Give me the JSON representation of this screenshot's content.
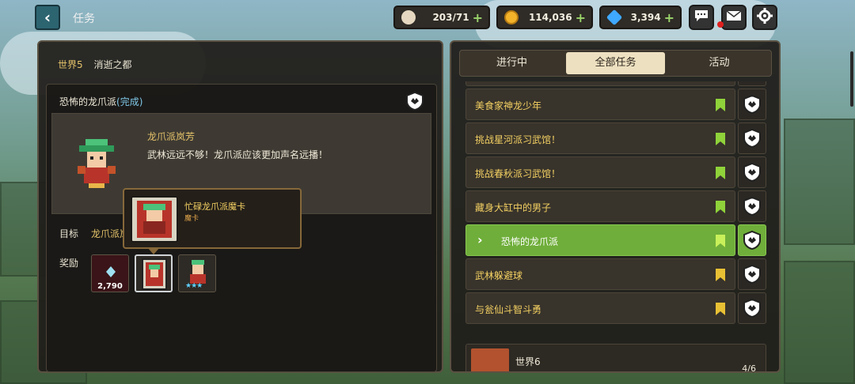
{
  "header": {
    "back_icon": "chevron-left-icon",
    "title": "任务",
    "resources": [
      {
        "name": "stamina",
        "icon": "coffee-cup-icon",
        "value": "203/71"
      },
      {
        "name": "gold",
        "icon": "gold-coin-icon",
        "value": "114,036"
      },
      {
        "name": "gems",
        "icon": "diamond-icon",
        "value": "3,394"
      }
    ],
    "buttons": [
      "chat-icon",
      "mail-icon",
      "gear-icon"
    ],
    "mail_has_notification": true
  },
  "left": {
    "world": "世界5",
    "area": "消逝之都",
    "quest_title": "恐怖的龙爪派",
    "quest_status": "(完成)",
    "npc_name": "龙爪派岚芳",
    "npc_line": "武林远远不够！龙爪派应该更加声名远播！",
    "goal_label": "目标",
    "goal_text": "龙爪派岚",
    "reward_label": "奖励",
    "rewards": [
      {
        "kind": "gem",
        "icon": "small-gem-icon",
        "qty": "2,790"
      },
      {
        "kind": "card",
        "icon": "card-icon",
        "qty": ""
      },
      {
        "kind": "hero",
        "icon": "hero-icon",
        "stars": "★★★"
      }
    ],
    "tooltip": {
      "name": "忙碌龙爪派魔卡",
      "type": "魔卡"
    }
  },
  "right": {
    "tabs": [
      {
        "label": "进行中",
        "active": false
      },
      {
        "label": "全部任务",
        "active": true
      },
      {
        "label": "活动",
        "active": false
      }
    ],
    "quests": [
      {
        "label": "",
        "bookmark": "#8fd23a",
        "active": false,
        "partial": true
      },
      {
        "label": "美食家神龙少年",
        "bookmark": "#8fd23a",
        "active": false
      },
      {
        "label": "挑战星河派习武馆！",
        "bookmark": "#8fd23a",
        "active": false
      },
      {
        "label": "挑战春秋派习武馆！",
        "bookmark": "#8fd23a",
        "active": false
      },
      {
        "label": "藏身大缸中的男子",
        "bookmark": "#8fd23a",
        "active": false
      },
      {
        "label": "恐怖的龙爪派",
        "bookmark": "#c8f05a",
        "active": true
      },
      {
        "label": "武林躲避球",
        "bookmark": "#e8c034",
        "active": false
      },
      {
        "label": "与瓮仙斗智斗勇",
        "bookmark": "#e8c034",
        "active": false
      }
    ],
    "next_world": {
      "label": "世界6",
      "progress": "4/6"
    }
  },
  "colors": {
    "accent_green": "#6fae3a",
    "gold_text": "#f3d062",
    "panel_bg": "#201e1b"
  }
}
